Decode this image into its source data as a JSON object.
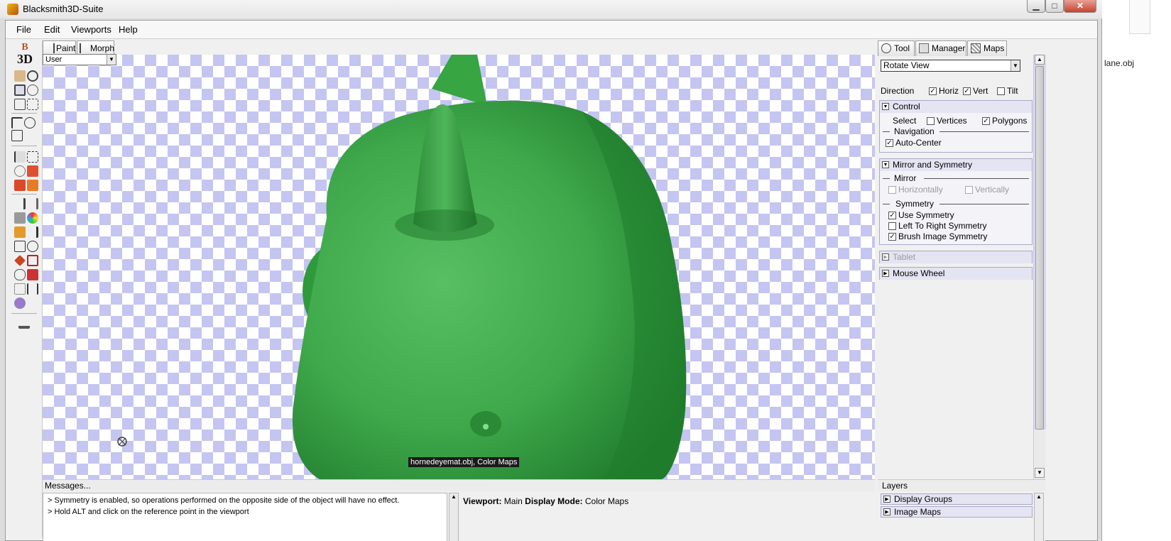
{
  "window": {
    "title": "Blacksmith3D-Suite"
  },
  "desktop": {
    "file_label": "lane.obj"
  },
  "menu": {
    "file": "File",
    "edit": "Edit",
    "viewports": "Viewports",
    "help": "Help"
  },
  "logo": {
    "top": "B",
    "bottom": "3D"
  },
  "viewport_tabs": {
    "paint": "Paint",
    "morph": "Morph"
  },
  "view_select": {
    "value": "User"
  },
  "viewport": {
    "label": "hornedeyemat.obj, Color Maps"
  },
  "panel_tabs": {
    "tool": "Tool",
    "manager": "Manager",
    "maps": "Maps"
  },
  "tool_select": {
    "value": "Rotate View"
  },
  "direction": {
    "label": "Direction",
    "horiz": {
      "label": "Horiz",
      "checked": true
    },
    "vert": {
      "label": "Vert",
      "checked": true
    },
    "tilt": {
      "label": "Tilt",
      "checked": false
    }
  },
  "control": {
    "title": "Control",
    "select_label": "Select",
    "vertices": {
      "label": "Vertices",
      "checked": false
    },
    "polygons": {
      "label": "Polygons",
      "checked": true
    },
    "navigation_label": "Navigation",
    "auto_center": {
      "label": "Auto-Center",
      "checked": true
    }
  },
  "mirror_symmetry": {
    "title": "Mirror and Symmetry",
    "mirror_label": "Mirror",
    "horizontally": {
      "label": "Horizontally",
      "checked": false,
      "enabled": false
    },
    "vertically": {
      "label": "Vertically",
      "checked": false,
      "enabled": false
    },
    "symmetry_label": "Symmetry",
    "use_symmetry": {
      "label": "Use Symmetry",
      "checked": true
    },
    "left_to_right": {
      "label": "Left To Right Symmetry",
      "checked": false
    },
    "brush_image": {
      "label": "Brush Image Symmetry",
      "checked": true
    }
  },
  "tablet": {
    "title": "Tablet",
    "enabled": false
  },
  "mouse_wheel": {
    "title": "Mouse Wheel"
  },
  "messages": {
    "header": "Messages...",
    "lines": [
      "> Symmetry is enabled, so operations performed on the opposite side of the object will have no effect.",
      "> Hold ALT and click on the reference point in the viewport"
    ]
  },
  "status": {
    "viewport_key": "Viewport:",
    "viewport_val": "Main",
    "mode_key": "Display Mode:",
    "mode_val": "Color Maps"
  },
  "layers": {
    "header": "Layers",
    "items": [
      "Display Groups",
      "Image Maps"
    ]
  },
  "colors": {
    "model_green": "#3faa4a",
    "checker": "#c5c5f2",
    "section_bg": "#e4e4f2"
  }
}
